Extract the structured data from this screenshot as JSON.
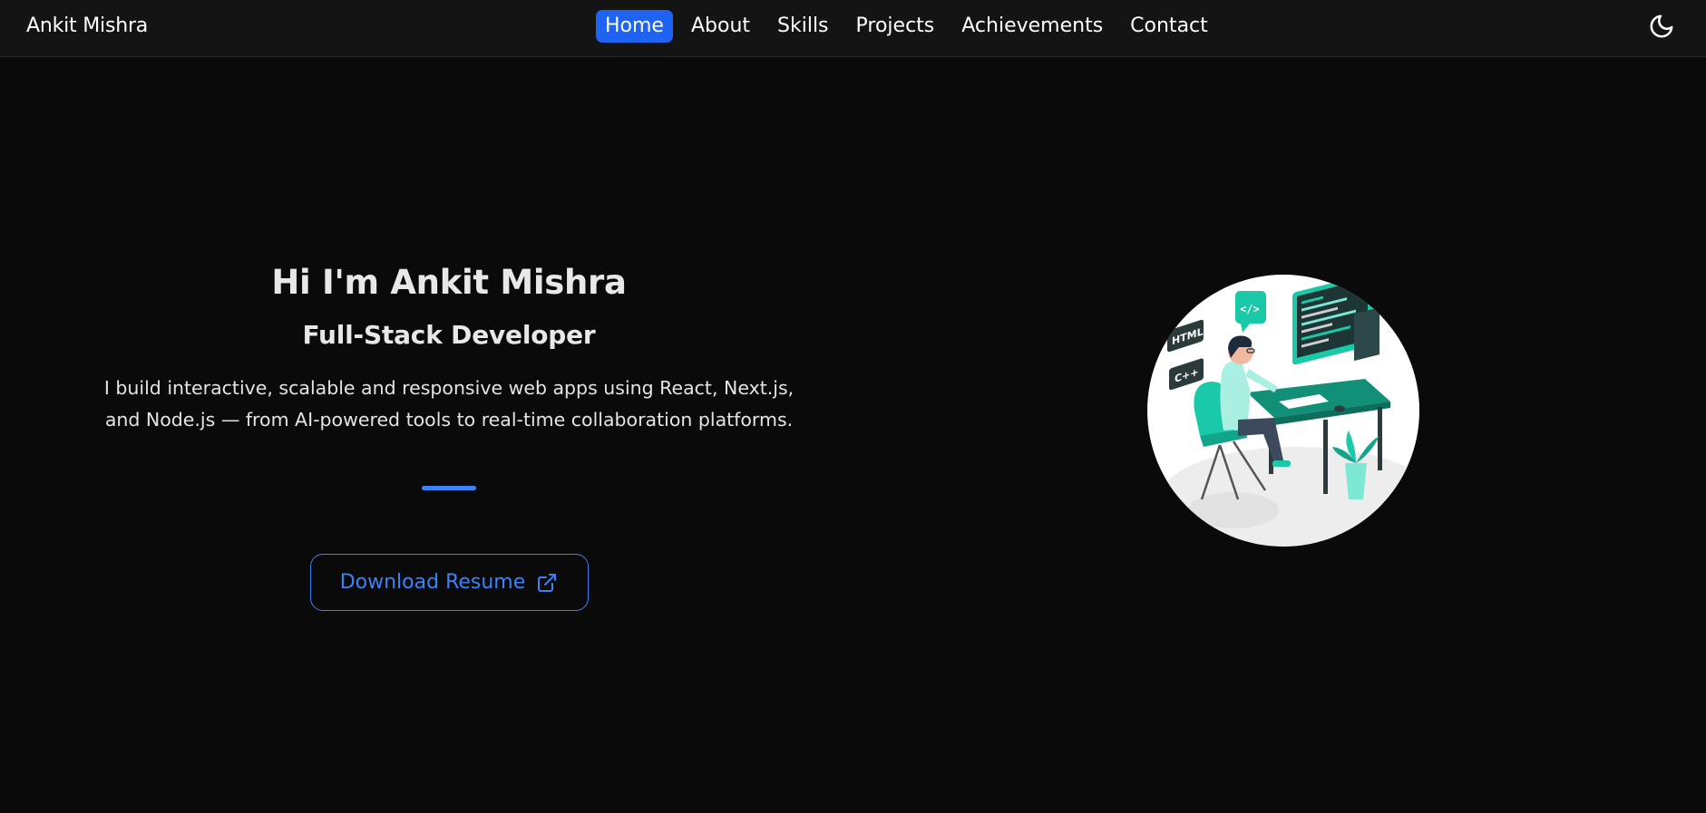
{
  "brand": "Ankit Mishra",
  "nav": {
    "items": [
      {
        "label": "Home",
        "active": true
      },
      {
        "label": "About"
      },
      {
        "label": "Skills"
      },
      {
        "label": "Projects"
      },
      {
        "label": "Achievements"
      },
      {
        "label": "Contact"
      }
    ],
    "theme_icon": "moon-icon"
  },
  "hero": {
    "title": "Hi I'm Ankit Mishra",
    "subtitle": "Full-Stack Developer",
    "description": "I build interactive, scalable and responsive web apps using React, Next.js, and Node.js — from AI-powered tools to real-time collaboration platforms.",
    "button_label": "Download Resume",
    "button_icon": "external-link-icon"
  },
  "illustration": {
    "tags": [
      "HTML",
      "C++"
    ],
    "code_badge": "</>"
  },
  "colors": {
    "background": "#0a0a0a",
    "navbar": "#141414",
    "accent": "#3b82f6",
    "active_nav": "#1f63f2",
    "illustration_teal": "#19c9a8"
  }
}
